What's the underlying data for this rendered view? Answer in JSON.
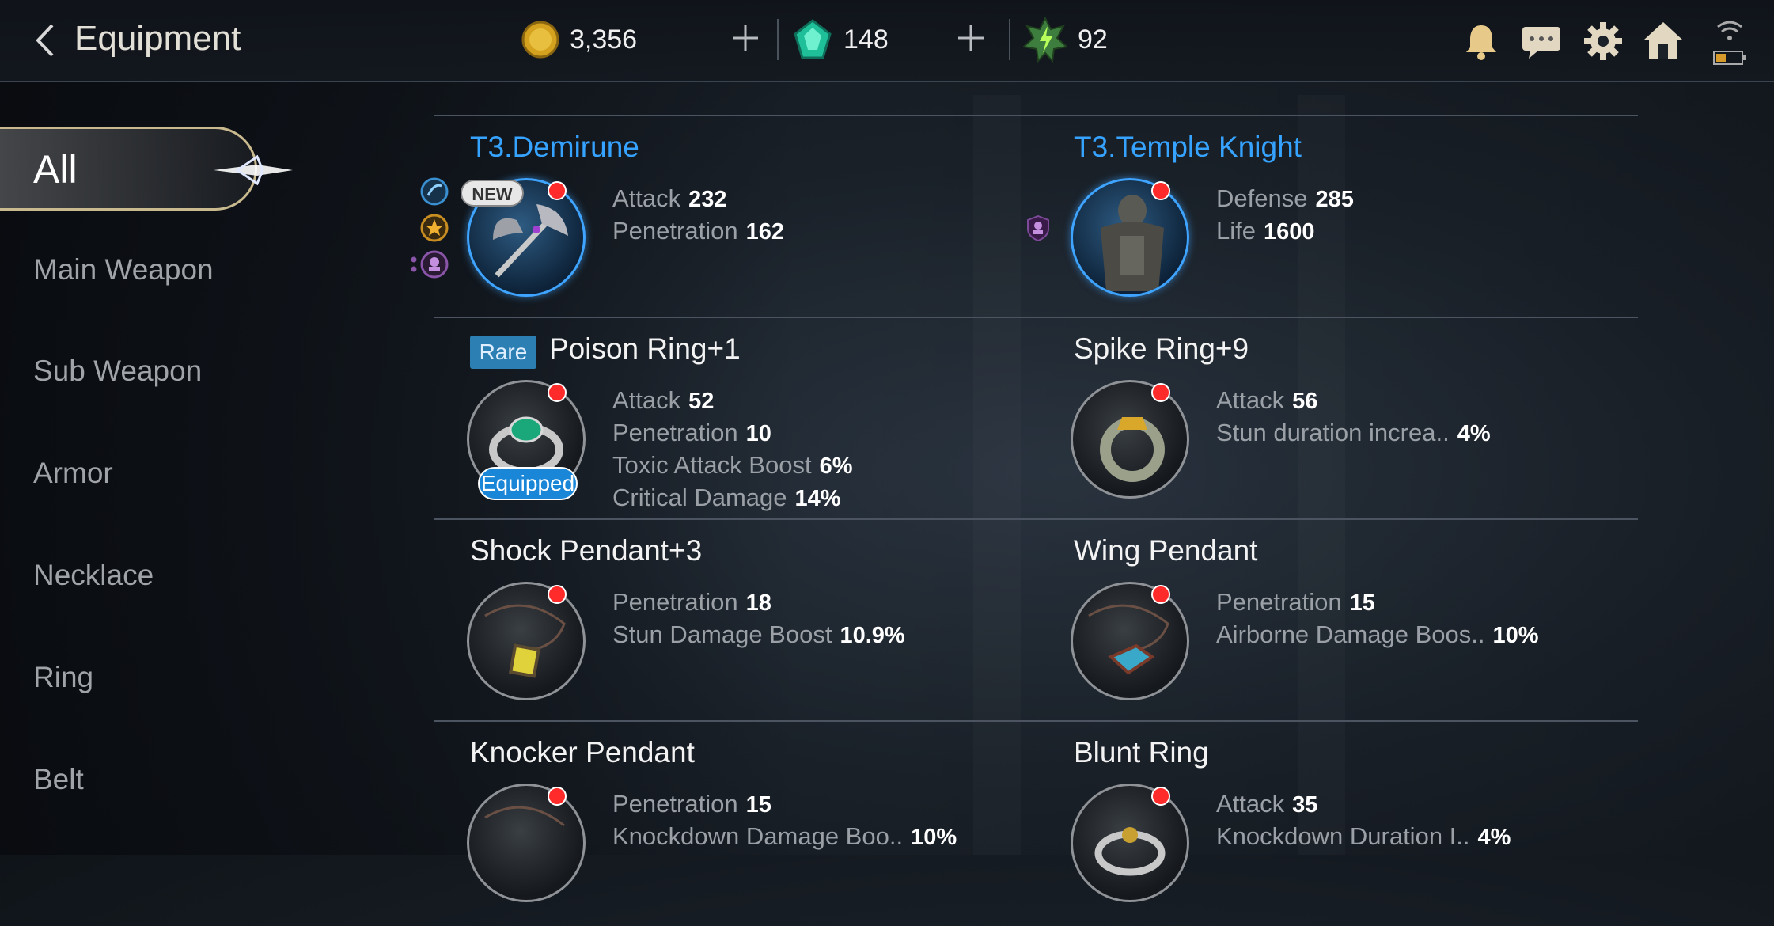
{
  "header": {
    "title": "Equipment",
    "gold": "3,356",
    "gems": "148",
    "energy": "92",
    "icons": [
      "bell-icon",
      "chat-icon",
      "gear-icon",
      "home-icon",
      "wifi-icon",
      "battery-icon"
    ]
  },
  "sidebar": {
    "items": [
      {
        "label": "All",
        "active": true
      },
      {
        "label": "Main Weapon"
      },
      {
        "label": "Sub Weapon"
      },
      {
        "label": "Armor"
      },
      {
        "label": "Necklace"
      },
      {
        "label": "Ring"
      },
      {
        "label": "Belt"
      }
    ]
  },
  "items": [
    {
      "name": "T3.Demirune",
      "new_badge": "NEW",
      "stats": [
        {
          "label": "Attack",
          "value": "232"
        },
        {
          "label": "Penetration",
          "value": "162"
        }
      ]
    },
    {
      "name": "T3.Temple Knight",
      "stats": [
        {
          "label": "Defense",
          "value": "285"
        },
        {
          "label": "Life",
          "value": "1600"
        }
      ]
    },
    {
      "rarity": "Rare",
      "name": "Poison Ring+1",
      "equipped": "Equipped",
      "stats": [
        {
          "label": "Attack",
          "value": "52"
        },
        {
          "label": "Penetration",
          "value": "10"
        },
        {
          "label": "Toxic Attack Boost",
          "value": "6%"
        },
        {
          "label": "Critical Damage",
          "value": "14%"
        }
      ]
    },
    {
      "name": "Spike Ring+9",
      "stats": [
        {
          "label": "Attack",
          "value": "56"
        },
        {
          "label": "Stun duration increa..",
          "value": "4%"
        }
      ]
    },
    {
      "name": "Shock Pendant+3",
      "stats": [
        {
          "label": "Penetration",
          "value": "18"
        },
        {
          "label": "Stun Damage Boost",
          "value": "10.9%"
        }
      ]
    },
    {
      "name": "Wing Pendant",
      "stats": [
        {
          "label": "Penetration",
          "value": "15"
        },
        {
          "label": "Airborne Damage Boos..",
          "value": "10%"
        }
      ]
    },
    {
      "name": "Knocker Pendant",
      "stats": [
        {
          "label": "Penetration",
          "value": "15"
        },
        {
          "label": "Knockdown Damage Boo..",
          "value": "10%"
        }
      ]
    },
    {
      "name": "Blunt Ring",
      "stats": [
        {
          "label": "Attack",
          "value": "35"
        },
        {
          "label": "Knockdown Duration I..",
          "value": "4%"
        }
      ]
    }
  ],
  "colors": {
    "accent_blue": "#35a3ff",
    "rare_tag": "#2b7fb3",
    "notify_red": "#ff2a2a"
  }
}
